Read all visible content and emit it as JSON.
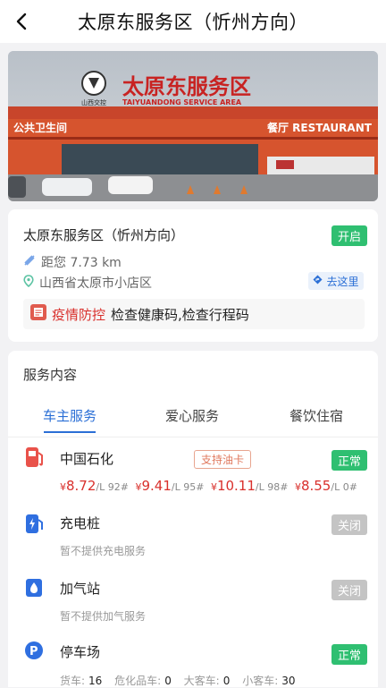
{
  "header": {
    "title": "太原东服务区（忻州方向）"
  },
  "photo": {
    "sign_main": "太原东服务区",
    "sign_sub": "TAIYUANDONG  SERVICE  AREA",
    "logo_text": "山西交控",
    "side_sign_left": "公共卫生间",
    "side_sign_right": "餐厅 RESTAURANT"
  },
  "info": {
    "name": "太原东服务区（忻州方向）",
    "status": "开启",
    "distance": "距您 7.73 km",
    "address": "山西省太原市小店区",
    "goto_label": "去这里",
    "notice_title": "疫情防控",
    "notice_text": "检查健康码,检查行程码"
  },
  "services": {
    "section_title": "服务内容",
    "tabs": [
      "车主服务",
      "爱心服务",
      "餐饮住宿"
    ],
    "fuel": {
      "name": "中国石化",
      "tag": "支持油卡",
      "status": "正常",
      "prices": [
        {
          "symbol": "¥",
          "value": "8.72",
          "unit": "/L",
          "grade": "92#"
        },
        {
          "symbol": "¥",
          "value": "9.41",
          "unit": "/L",
          "grade": "95#"
        },
        {
          "symbol": "¥",
          "value": "10.11",
          "unit": "/L",
          "grade": "98#"
        },
        {
          "symbol": "¥",
          "value": "8.55",
          "unit": "/L",
          "grade": "0#"
        }
      ]
    },
    "charging": {
      "name": "充电桩",
      "status": "关闭",
      "note": "暂不提供充电服务"
    },
    "gas": {
      "name": "加气站",
      "status": "关闭",
      "note": "暂不提供加气服务"
    },
    "parking": {
      "name": "停车场",
      "status": "正常",
      "truck_label": "货车:",
      "truck": "16",
      "hazard_label": "危化品车:",
      "hazard": "0",
      "bus_label": "大客车:",
      "bus": "0",
      "car_label": "小客车:",
      "car": "30"
    }
  },
  "colors": {
    "accent": "#2b6fd6",
    "green": "#2fbf71",
    "red": "#d9302c",
    "grey": "#c4c4c4"
  }
}
